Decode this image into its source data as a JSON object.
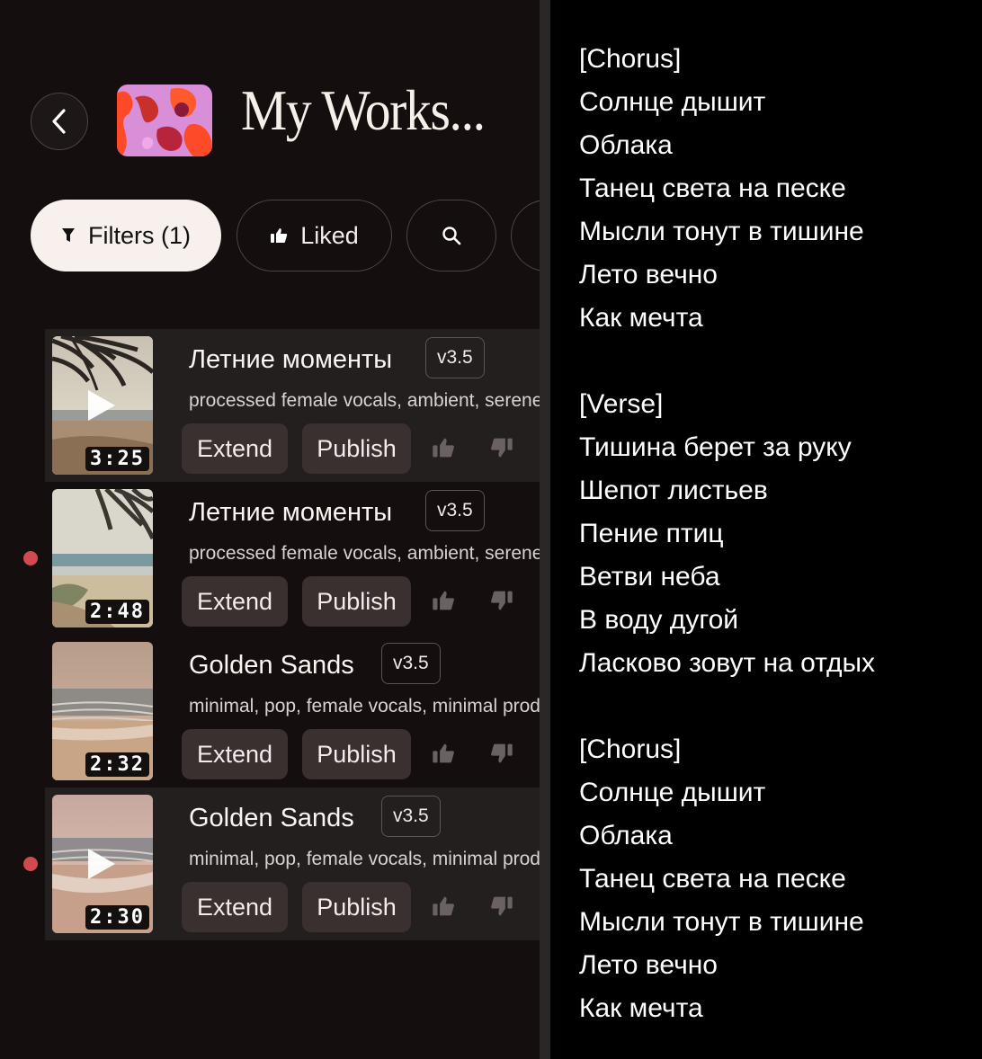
{
  "header": {
    "title": "My Works...",
    "back_icon": "chevron-left-icon"
  },
  "filters": {
    "filters_label": "Filters (1)",
    "liked_label": "Liked"
  },
  "songs": [
    {
      "title": "Летние моменты",
      "version": "v3.5",
      "tags": "processed female vocals, ambient, serene",
      "duration": "3:25",
      "extend": "Extend",
      "publish": "Publish"
    },
    {
      "title": "Летние моменты",
      "version": "v3.5",
      "tags": "processed female vocals, ambient, serene",
      "duration": "2:48",
      "extend": "Extend",
      "publish": "Publish"
    },
    {
      "title": "Golden Sands",
      "version": "v3.5",
      "tags": "minimal, pop, female vocals, minimal production",
      "duration": "2:32",
      "extend": "Extend",
      "publish": "Publish"
    },
    {
      "title": "Golden Sands",
      "version": "v3.5",
      "tags": "minimal, pop, female vocals, minimal production",
      "duration": "2:30",
      "extend": "Extend",
      "publish": "Publish"
    }
  ],
  "lyrics": [
    "[Chorus]",
    "Солнце дышит",
    "Облака",
    "Танец света на песке",
    "Мысли тонут в тишине",
    "Лето вечно",
    "Как мечта",
    "",
    "[Verse]",
    "Тишина берет за руку",
    "Шепот листьев",
    "Пение птиц",
    "Ветви неба",
    "В воду дугой",
    "Ласково зовут на отдых",
    "",
    "[Chorus]",
    "Солнце дышит",
    "Облака",
    "Танец света на песке",
    "Мысли тонут в тишине",
    "Лето вечно",
    "Как мечта"
  ],
  "colors": {
    "background": "#140e0e",
    "accent_dot": "#d04a4f",
    "button": "#39302f"
  }
}
